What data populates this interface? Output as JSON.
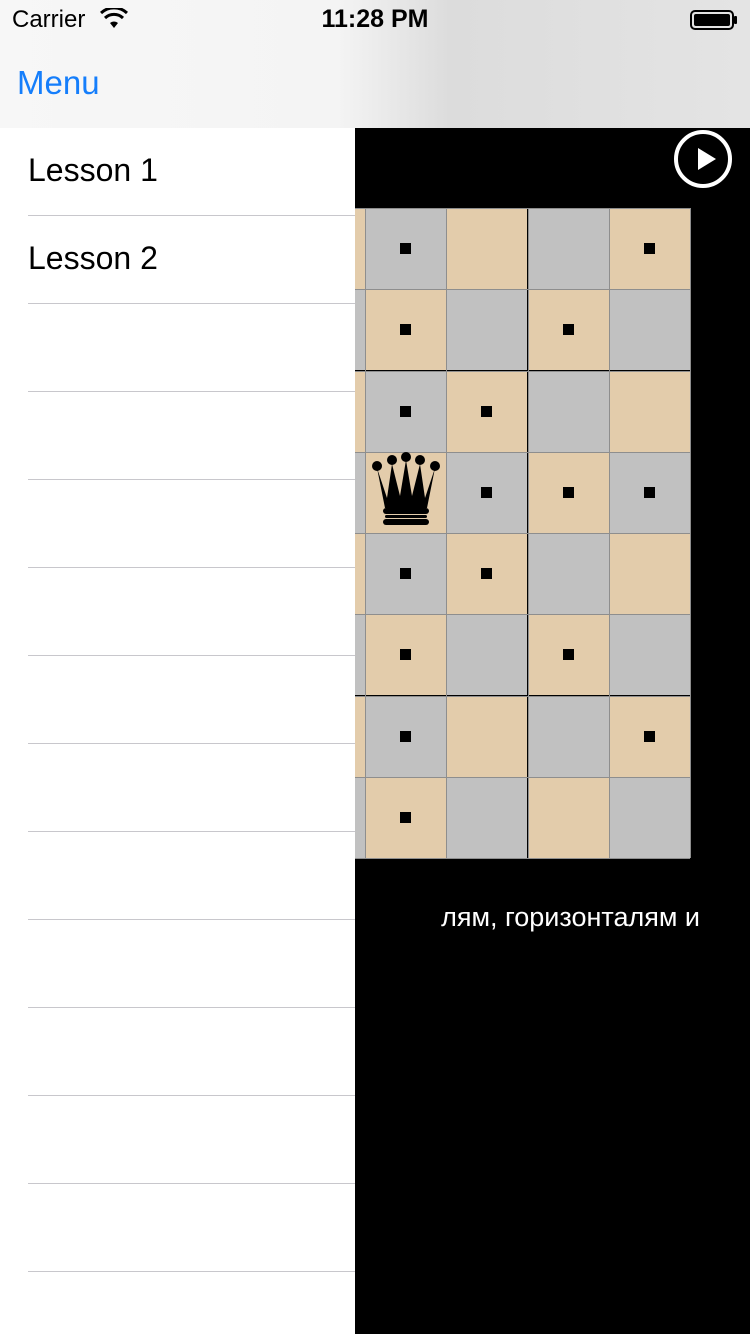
{
  "status_bar": {
    "carrier": "Carrier",
    "time": "11:28 PM"
  },
  "nav": {
    "title": "Menu"
  },
  "menu": {
    "items": [
      {
        "label": "Lesson 1"
      },
      {
        "label": "Lesson 2"
      },
      {
        "label": ""
      },
      {
        "label": ""
      },
      {
        "label": ""
      },
      {
        "label": ""
      },
      {
        "label": ""
      },
      {
        "label": ""
      },
      {
        "label": ""
      },
      {
        "label": ""
      },
      {
        "label": ""
      },
      {
        "label": ""
      },
      {
        "label": ""
      },
      {
        "label": ""
      }
    ]
  },
  "lesson": {
    "text": "лям, горизонталям и",
    "board": {
      "files": 8,
      "ranks": 8,
      "queen": {
        "col": 4,
        "row": 3,
        "color": "black",
        "icon": "queen-icon"
      },
      "move_markers": [
        [
          0,
          4
        ],
        [
          0,
          7
        ],
        [
          1,
          4
        ],
        [
          1,
          6
        ],
        [
          2,
          4
        ],
        [
          2,
          5
        ],
        [
          3,
          5
        ],
        [
          3,
          6
        ],
        [
          3,
          7
        ],
        [
          4,
          4
        ],
        [
          4,
          5
        ],
        [
          5,
          4
        ],
        [
          5,
          6
        ],
        [
          6,
          4
        ],
        [
          6,
          7
        ],
        [
          7,
          4
        ]
      ]
    }
  },
  "colors": {
    "light_square": "#e3ccab",
    "dark_square": "#c1c1c1",
    "accent": "#157efb"
  },
  "icons": {
    "play": "play-icon",
    "wifi": "wifi-icon",
    "battery": "battery-icon"
  }
}
